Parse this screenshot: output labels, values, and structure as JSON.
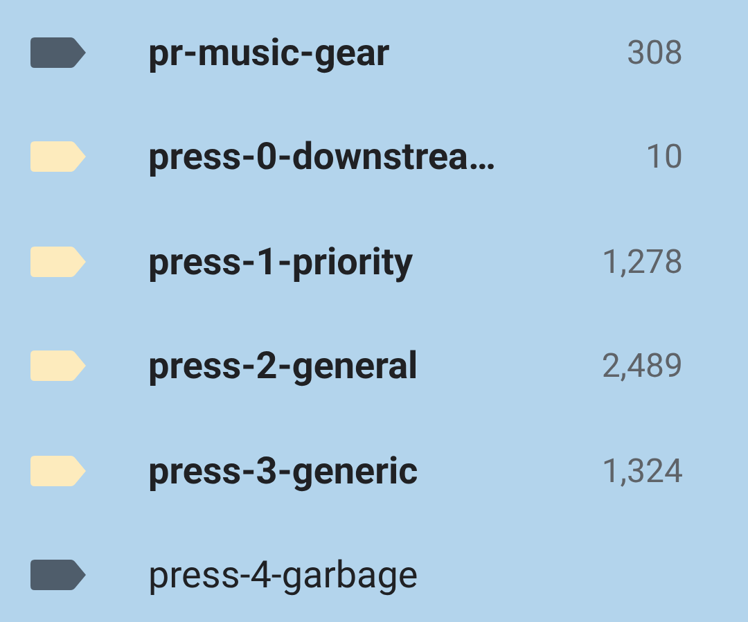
{
  "labels": [
    {
      "name": "pr-music-gear",
      "count": "308",
      "unread": true,
      "color": "#4f5d6b"
    },
    {
      "name": "press-0-downstrea…",
      "count": "10",
      "unread": true,
      "color": "#fdebbd"
    },
    {
      "name": "press-1-priority",
      "count": "1,278",
      "unread": true,
      "color": "#fdebbd"
    },
    {
      "name": "press-2-general",
      "count": "2,489",
      "unread": true,
      "color": "#fdebbd"
    },
    {
      "name": "press-3-generic",
      "count": "1,324",
      "unread": true,
      "color": "#fdebbd"
    },
    {
      "name": "press-4-garbage",
      "unread": false,
      "color": "#4f5d6b"
    }
  ]
}
